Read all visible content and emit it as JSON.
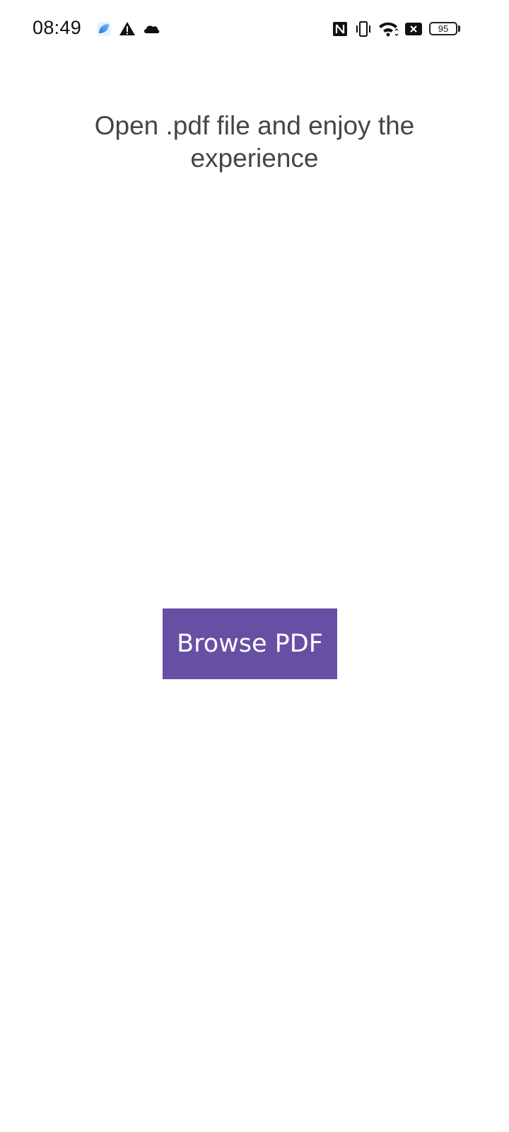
{
  "status_bar": {
    "time": "08:49",
    "battery_level": "95",
    "icons": [
      "app-notification-icon",
      "warning-icon",
      "cloud-icon",
      "nfc-icon",
      "vibrate-icon",
      "wifi-icon",
      "no-sim-icon",
      "battery-icon"
    ]
  },
  "main": {
    "title": "Open .pdf file and enjoy the experience",
    "browse_button_label": "Browse PDF"
  },
  "colors": {
    "accent": "#6750a4",
    "title_text": "#454545",
    "background": "#ffffff"
  }
}
